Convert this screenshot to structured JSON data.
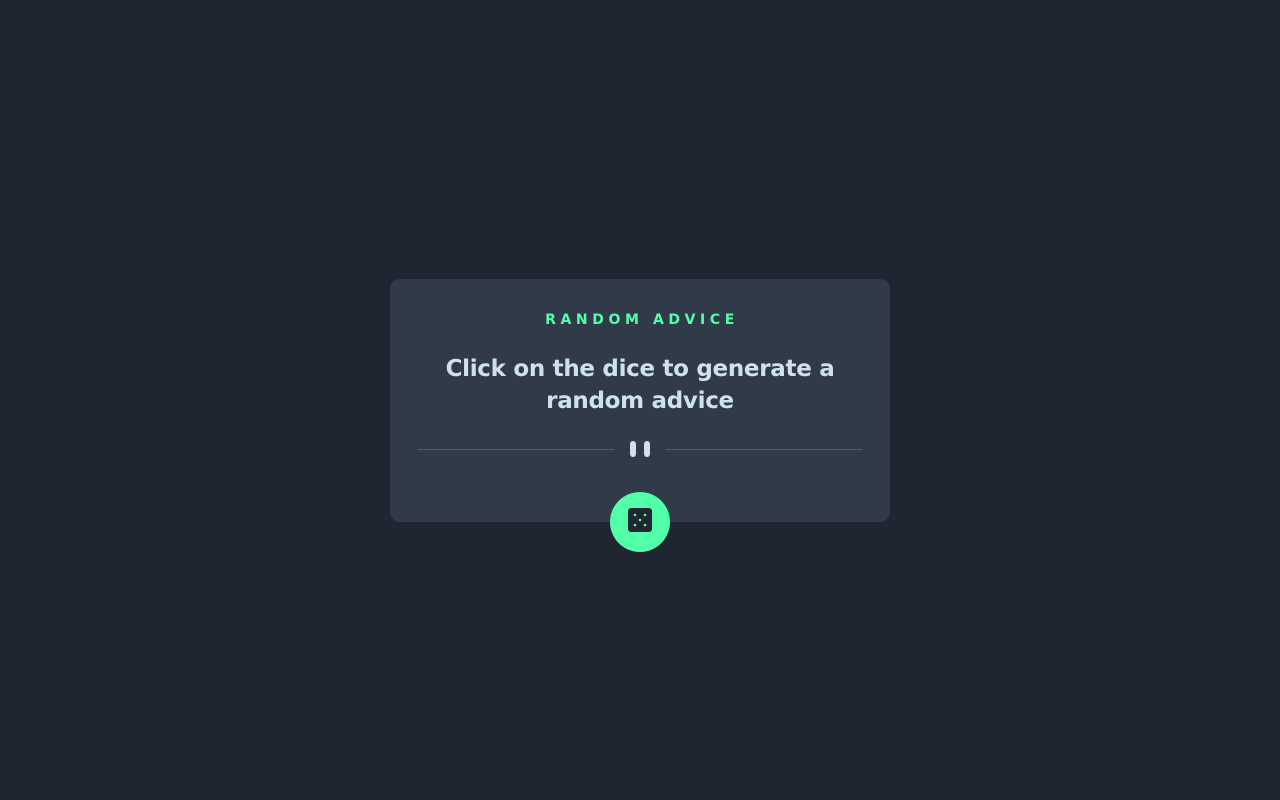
{
  "card": {
    "title": "RANDOM ADVICE",
    "advice": "Click on the dice to generate a random advice"
  },
  "divider": {
    "icon": "pause-icon"
  },
  "dice_button": {
    "icon": "dice-icon"
  },
  "colors": {
    "background": "#1f2632",
    "card": "#313a48",
    "accent": "#52ffa8",
    "text": "#cee3e9",
    "divider": "#4f5d74"
  }
}
